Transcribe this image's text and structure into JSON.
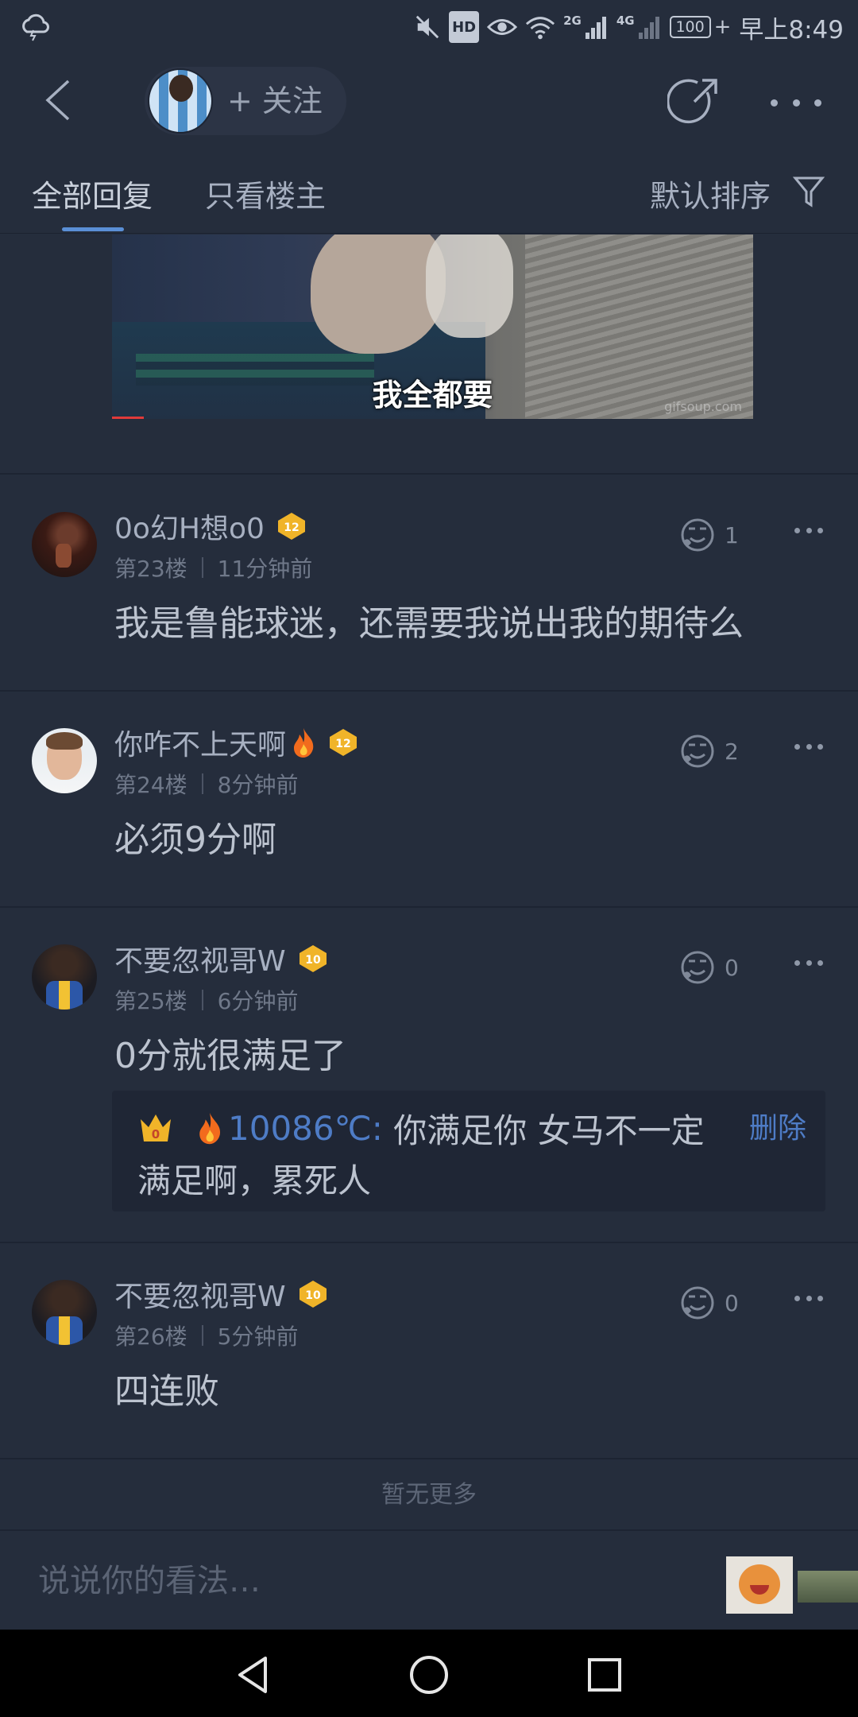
{
  "status_bar": {
    "network_2g": "2G",
    "network_4g": "4G",
    "hd_label": "HD",
    "battery": "100",
    "time": "早上8:49"
  },
  "header": {
    "follow_label": "+ 关注",
    "icons": [
      "back-arrow-icon",
      "share-icon",
      "more-dots-icon"
    ]
  },
  "tabs": {
    "all_replies": "全部回复",
    "op_only": "只看楼主",
    "sort": "默认排序"
  },
  "meme": {
    "caption": "我全都要",
    "watermark": "gifsoup.com"
  },
  "comments": [
    {
      "username": "0o幻H想o0",
      "level": "12",
      "floor": "第23楼",
      "time": "11分钟前",
      "text": "我是鲁能球迷，还需要我说出我的期待么",
      "likes": "1"
    },
    {
      "username": "你咋不上天啊",
      "level": "12",
      "floor": "第24楼",
      "time": "8分钟前",
      "text": "必须9分啊",
      "likes": "2"
    },
    {
      "username": "不要忽视哥W",
      "level": "10",
      "floor": "第25楼",
      "time": "6分钟前",
      "text": "0分就很满足了",
      "likes": "0",
      "sub_reply": {
        "crown_level": "0",
        "user": "10086℃",
        "line1": "你满足你  女马不一定",
        "line2": "满足啊，累死人",
        "delete_label": "删除"
      }
    },
    {
      "username": "不要忽视哥W",
      "level": "10",
      "floor": "第26楼",
      "time": "5分钟前",
      "text": "四连败",
      "likes": "0"
    }
  ],
  "footer": {
    "no_more": "暂无更多",
    "reply_placeholder": "说说你的看法…"
  },
  "colors": {
    "background": "#252d3c",
    "accent_blue": "#4e7cc6",
    "level_badge": "#f0b429"
  }
}
